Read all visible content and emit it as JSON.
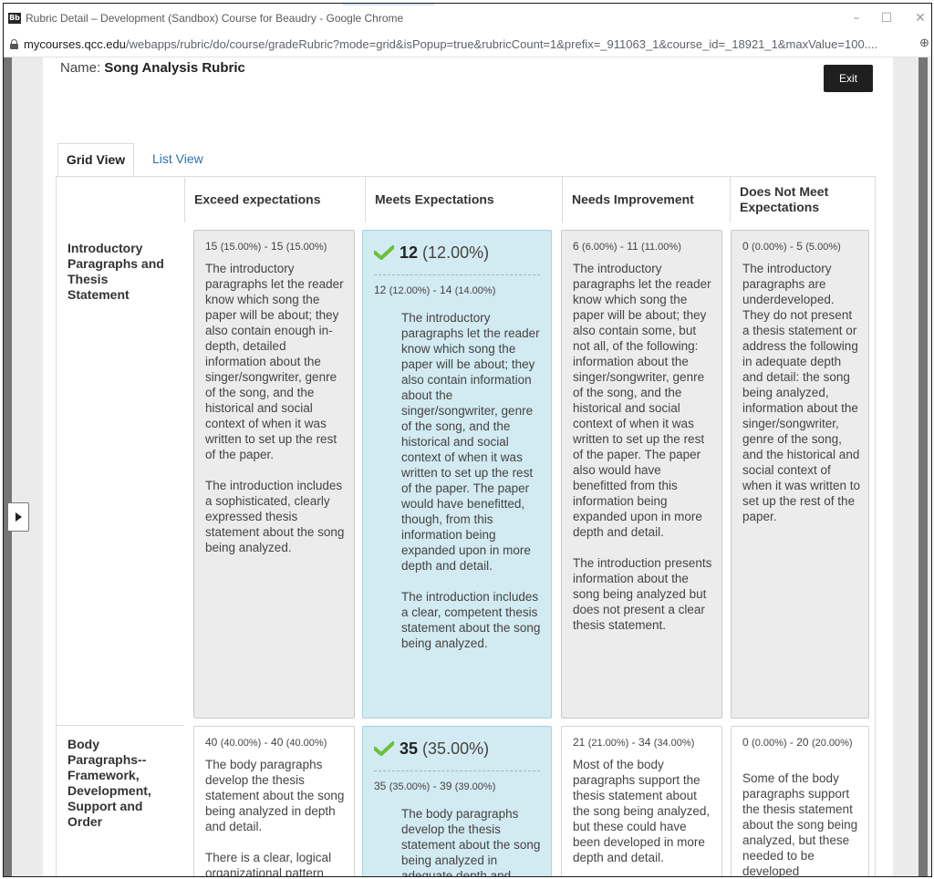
{
  "window": {
    "title": "Rubric Detail – Development (Sandbox) Course for Beaudry - Google Chrome",
    "app_icon": "Bb",
    "minimize": "–",
    "maximize": "☐",
    "close": "✕"
  },
  "address_bar": {
    "host": "mycourses.qcc.edu",
    "path": "/webapps/rubric/do/course/gradeRubric?mode=grid&isPopup=true&rubricCount=1&prefix=_911063_1&course_id=_18921_1&maxValue=100....",
    "ext_icon": "⊕"
  },
  "rubric": {
    "name_label": "Name:",
    "name": "Song Analysis Rubric",
    "exit_label": "Exit"
  },
  "tabs": {
    "grid": "Grid View",
    "list": "List View"
  },
  "columns": [
    "Exceed expectations",
    "Meets Expectations",
    "Needs Improvement",
    "Does Not Meet Expectations"
  ],
  "rows": [
    {
      "criterion": "Introductory Paragraphs and Thesis Statement",
      "selected_score": "12",
      "selected_pct": "(12.00%)",
      "cells": [
        {
          "range_a": "15",
          "pct_a": "(15.00%)",
          "range_b": "15",
          "pct_b": "(15.00%)",
          "text": "The introductory paragraphs let the reader know which song the paper will be about; they also contain enough in-depth, detailed information about the singer/songwriter, genre of the song, and the historical and social context of when it was written to set up the rest of the paper.\n\nThe introduction includes a sophisticated, clearly expressed thesis statement about the song being analyzed."
        },
        {
          "range_a": "12",
          "pct_a": "(12.00%)",
          "range_b": "14",
          "pct_b": "(14.00%)",
          "text": "The introductory paragraphs let the reader know which song the paper will be about; they also contain information about the singer/songwriter, genre of the song, and the historical and social context of when it was written to set up the rest of the paper. The paper would have benefitted, though, from this information being expanded upon in more depth and detail.\n\nThe introduction includes a clear, competent thesis statement about the song being analyzed."
        },
        {
          "range_a": "6",
          "pct_a": "(6.00%)",
          "range_b": "11",
          "pct_b": "(11.00%)",
          "text": "The introductory paragraphs let the reader know which song the paper will be about; they also contain some, but not all, of the following: information about the singer/songwriter, genre of the song, and the historical and social context of when it was written to set up the rest of the paper. The paper also would have benefitted from this information being expanded upon in more depth and detail.\n\nThe introduction presents information about the song being analyzed but does not present a clear thesis statement."
        },
        {
          "range_a": "0",
          "pct_a": "(0.00%)",
          "range_b": "5",
          "pct_b": "(5.00%)",
          "text": "The introductory paragraphs are underdeveloped. They do not present a thesis statement or address the following in adequate depth and detail: the song being analyzed, information about the singer/songwriter, genre of the song, and the historical and social context of when it was written to set up the rest of the paper."
        }
      ]
    },
    {
      "criterion": "Body Paragraphs--Framework, Development, Support and Order",
      "selected_score": "35",
      "selected_pct": "(35.00%)",
      "cells": [
        {
          "range_a": "40",
          "pct_a": "(40.00%)",
          "range_b": "40",
          "pct_b": "(40.00%)",
          "text": "The body paragraphs develop the thesis statement about the song being analyzed in depth and detail.\n\nThere is a clear, logical organizational pattern"
        },
        {
          "range_a": "35",
          "pct_a": "(35.00%)",
          "range_b": "39",
          "pct_b": "(39.00%)",
          "text": "The body paragraphs develop the thesis statement about the song being analyzed in adequate depth and detail"
        },
        {
          "range_a": "21",
          "pct_a": "(21.00%)",
          "range_b": "34",
          "pct_b": "(34.00%)",
          "text": "Most of the body paragraphs support the thesis statement about the song being analyzed, but these could have been developed in more depth and detail."
        },
        {
          "range_a": "0",
          "pct_a": "(0.00%)",
          "range_b": "20",
          "pct_b": "(20.00%)",
          "text": "Some of the body paragraphs support the thesis statement about the song being analyzed, but these needed to be developed"
        }
      ]
    }
  ],
  "icons": {
    "check": "checkmark-icon",
    "expand": "expand-arrow-icon",
    "lock": "lock-icon"
  },
  "colors": {
    "selected_cell": "#d2eaf1",
    "check": "#6cbf3a",
    "exit_button": "#1f1f1f",
    "link": "#2a6fb3"
  }
}
